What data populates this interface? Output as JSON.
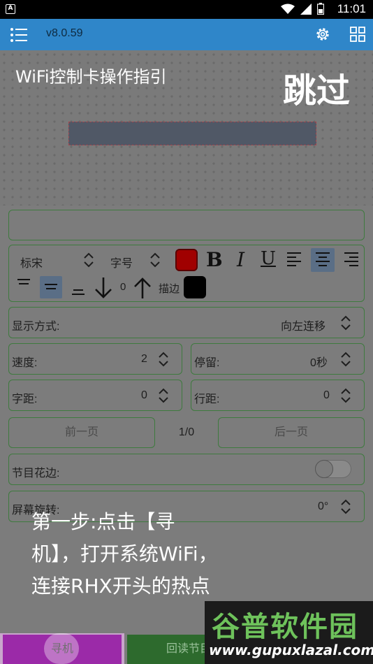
{
  "status_bar": {
    "left_badge": "A",
    "time": "11:01",
    "icons": [
      "wifi-icon",
      "signal-icon",
      "battery-icon"
    ]
  },
  "app_bar": {
    "version": "v8.0.59",
    "icons": [
      "menu-icon",
      "gear-icon",
      "grid-icon"
    ]
  },
  "overlay": {
    "title": "WiFi控制卡操作指引",
    "skip": "跳过",
    "guide_lines": [
      "第一步:点击【寻",
      "机】，打开系统WiFi，",
      "连接RHX开头的热点"
    ]
  },
  "editor": {
    "text_input_value": "",
    "font_family": "标宋",
    "font_size": "字号",
    "text_color": "#a00000",
    "stroke_color": "#000000",
    "line_spacing_value": "0",
    "stroke_label": "描边",
    "bold": "B",
    "italic": "I",
    "underline": "U"
  },
  "settings": {
    "display_mode_label": "显示方式:",
    "display_mode_value": "向左连移",
    "speed_label": "速度:",
    "speed_value": "2",
    "stay_label": "停留:",
    "stay_value": "0秒",
    "char_spacing_label": "字距:",
    "char_spacing_value": "0",
    "line_spacing_label": "行距:",
    "line_spacing_value": "0",
    "prev_page": "前一页",
    "page_indicator": "1/0",
    "next_page": "后一页",
    "border_label": "节目花边:",
    "border_enabled": false,
    "rotation_label": "屏幕旋转:",
    "rotation_value": "0°"
  },
  "bottom": {
    "search_button": "寻机",
    "readback_button": "回读节目"
  },
  "watermark": {
    "title": "谷普软件园",
    "url": "www.gupuxlazal.com"
  },
  "colors": {
    "accent_bar": "#2f86c9",
    "field_border": "#3e7a3e",
    "search_button_bg": "#9b2aa8",
    "readback_button_bg": "#2d6a2d"
  }
}
